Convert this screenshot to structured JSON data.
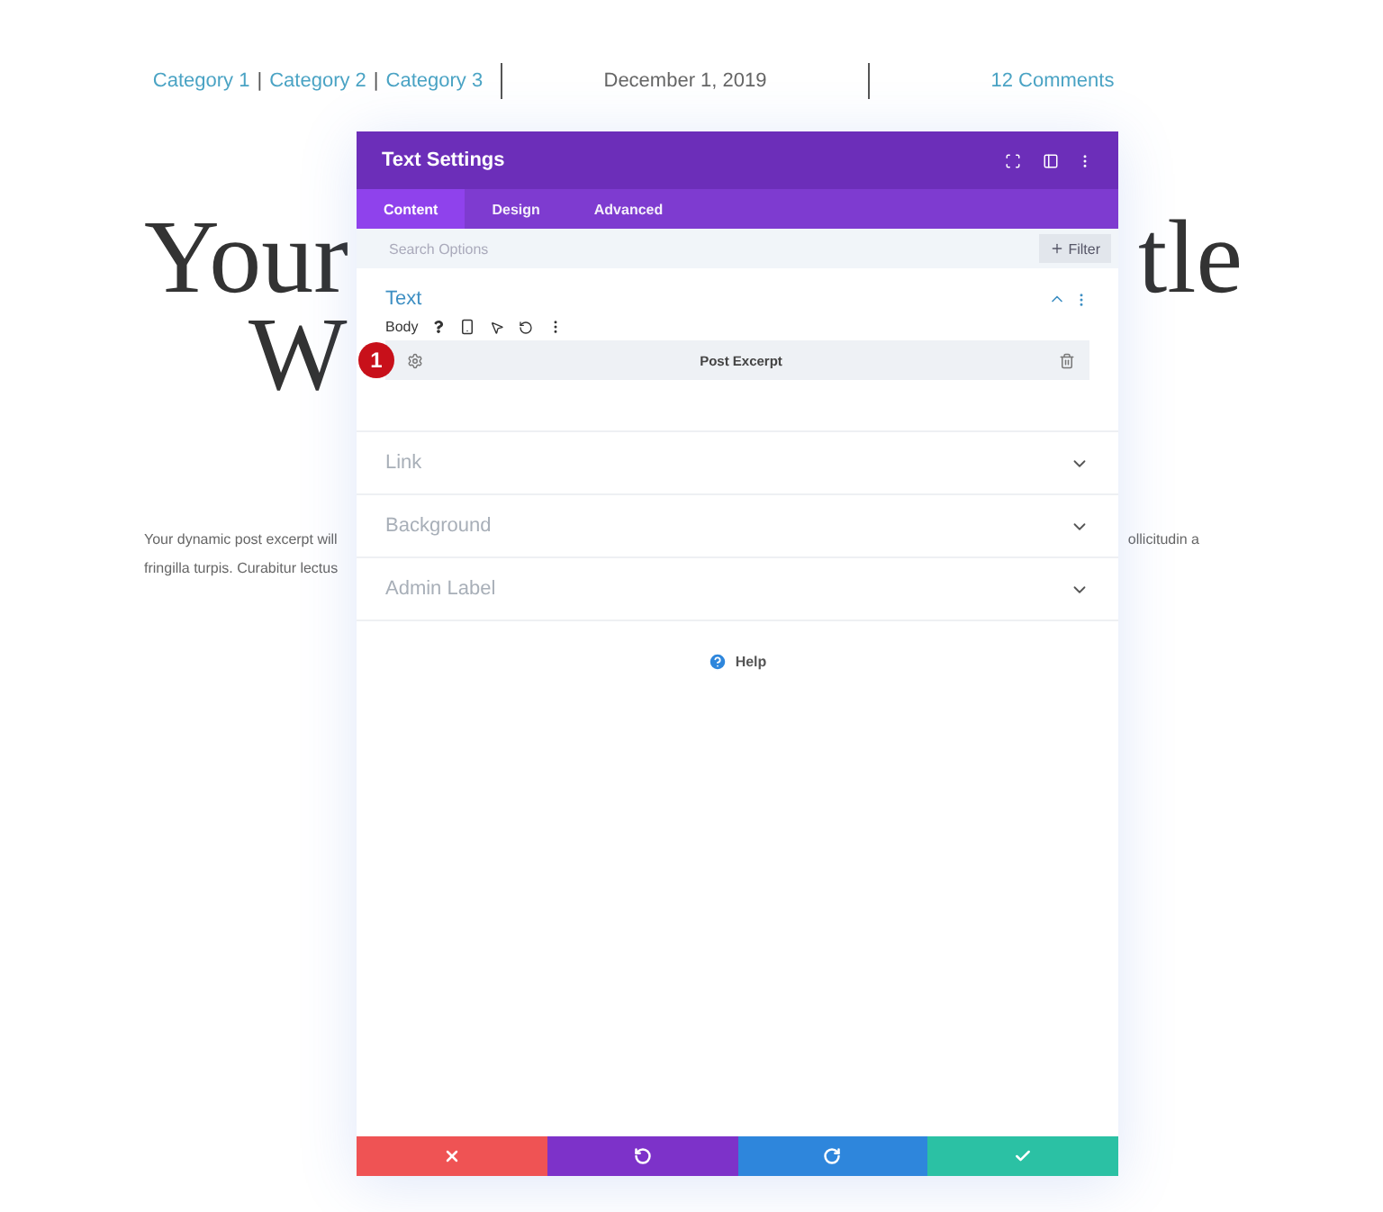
{
  "post_meta": {
    "categories": [
      "Category 1",
      "Category 2",
      "Category 3"
    ],
    "separator": "|",
    "date": "December 1, 2019",
    "comments": "12 Comments"
  },
  "post_title": {
    "line_1_left": "Your",
    "line_1_right": "tle",
    "line_2_left": "W"
  },
  "excerpt": {
    "line_1_left": "Your dynamic post excerpt will",
    "line_1_right": "ollicitudin a",
    "line_2_left": "fringilla turpis. Curabitur lectus"
  },
  "modal": {
    "title": "Text Settings",
    "tabs": [
      {
        "label": "Content",
        "selected": true
      },
      {
        "label": "Design",
        "selected": false
      },
      {
        "label": "Advanced",
        "selected": false
      }
    ],
    "search": {
      "placeholder": "Search Options"
    },
    "filter_button": "Filter",
    "sections": [
      {
        "title": "Text",
        "expanded": true,
        "field_label": "Body",
        "dynamic_value": {
          "badge": "1",
          "label": "Post Excerpt"
        }
      },
      {
        "title": "Link",
        "expanded": false
      },
      {
        "title": "Background",
        "expanded": false
      },
      {
        "title": "Admin Label",
        "expanded": false
      }
    ],
    "help": "Help",
    "footer_buttons": [
      {
        "kind": "cancel"
      },
      {
        "kind": "undo"
      },
      {
        "kind": "redo"
      },
      {
        "kind": "save"
      }
    ]
  }
}
